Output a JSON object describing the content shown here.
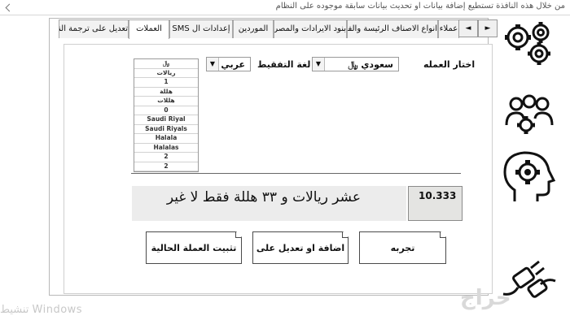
{
  "window": {
    "title": "من خلال هذه النافذة تستطيع إضافة بيانات او تحديث بيانات سابقة موجوده على النظام"
  },
  "nav": {
    "next": "►",
    "prev": "◄"
  },
  "tabs": [
    {
      "label": "تعديل على ترجمة النظام"
    },
    {
      "label": "العملات"
    },
    {
      "label": "إعدادات ال SMS"
    },
    {
      "label": "الموردين"
    },
    {
      "label": "بنود الايرادات والمصروفات"
    },
    {
      "label": "انواع الاصناف الرئيسة والفرعيه"
    },
    {
      "label": "عملاء"
    }
  ],
  "form": {
    "currency_label": "اختار العمله",
    "currency_value": "سعودي ﷼",
    "lang_label": "لغة التفقيط",
    "lang_value": "عربي",
    "list_items": [
      "﷼",
      "ريالات",
      "1",
      "هللة",
      "هللات",
      "0",
      "Saudi Riyal",
      "Saudi Riyals",
      "Halala",
      "Halalas",
      "2",
      "2"
    ]
  },
  "result": {
    "words": "عشر ريالات و ٣٣ هللة فقط لا غير",
    "number": "10.333"
  },
  "buttons": {
    "try": "تجربه",
    "add_edit": "اضافة او تعديل على عمله",
    "pin": "تثبيت العملة الحالية"
  },
  "watermark": {
    "os": "تنشيط Windows",
    "site": "حراج"
  },
  "icons": [
    "gears-icon",
    "users-settings-icon",
    "head-gear-icon",
    "plug-icon"
  ]
}
